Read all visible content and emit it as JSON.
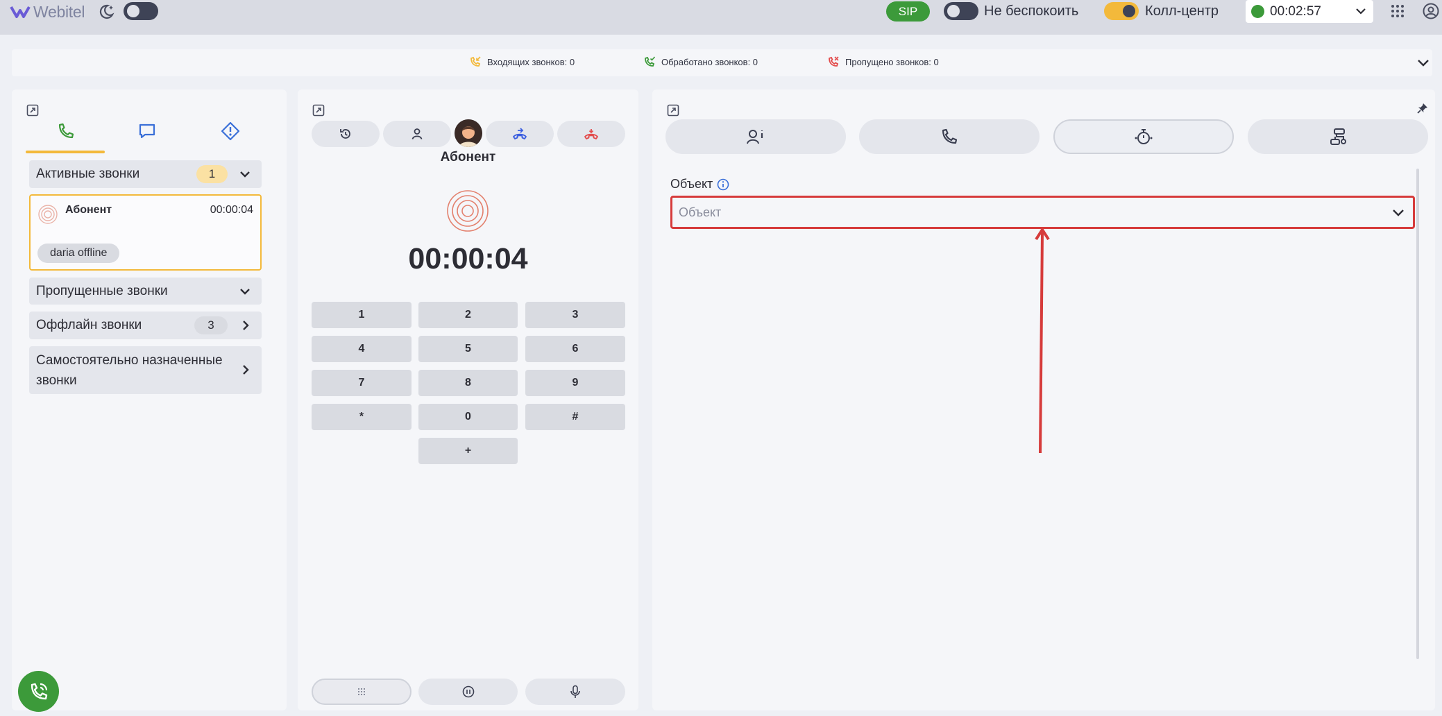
{
  "app": {
    "logo_text": "Webitel"
  },
  "topbar": {
    "sip_label": "SIP",
    "dnd_label": "Не беспокоить",
    "callcenter_label": "Колл-центр",
    "status_timer": "00:02:57",
    "status_color": "#3c9a3a"
  },
  "stats": {
    "incoming": "Входящих звонков: 0",
    "processed": "Обработано звонков: 0",
    "missed": "Пропущено звонков: 0"
  },
  "left": {
    "tabs": [
      {
        "icon": "phone-icon",
        "active": true
      },
      {
        "icon": "chat-icon",
        "active": false
      },
      {
        "icon": "warning-diamond-icon",
        "active": false
      }
    ],
    "active_calls": {
      "title": "Активные звонки",
      "count": "1"
    },
    "call_card": {
      "name": "Абонент",
      "duration": "00:00:04",
      "tag": "daria offline"
    },
    "missed_calls": {
      "title": "Пропущенные звонки"
    },
    "offline_calls": {
      "title": "Оффлайн звонки",
      "count": "3"
    },
    "self_assigned": {
      "title": "Самостоятельно назначенные звонки"
    }
  },
  "middle": {
    "caller_name": "Абонент",
    "timer": "00:00:04",
    "keypad": [
      "1",
      "2",
      "3",
      "4",
      "5",
      "6",
      "7",
      "8",
      "9",
      "*",
      "0",
      "#",
      "+"
    ]
  },
  "right": {
    "tabs": [
      {
        "icon": "contact-info-icon"
      },
      {
        "icon": "phone-icon"
      },
      {
        "icon": "timer-icon",
        "active": true
      },
      {
        "icon": "flow-icon"
      }
    ],
    "field_label": "Объект",
    "field_placeholder": "Объект"
  },
  "colors": {
    "accent_yellow": "#f3b93b",
    "green": "#3c9a3a",
    "blue": "#3a6fd8",
    "red": "#e34b4b",
    "highlight_red": "#d63b3b"
  }
}
